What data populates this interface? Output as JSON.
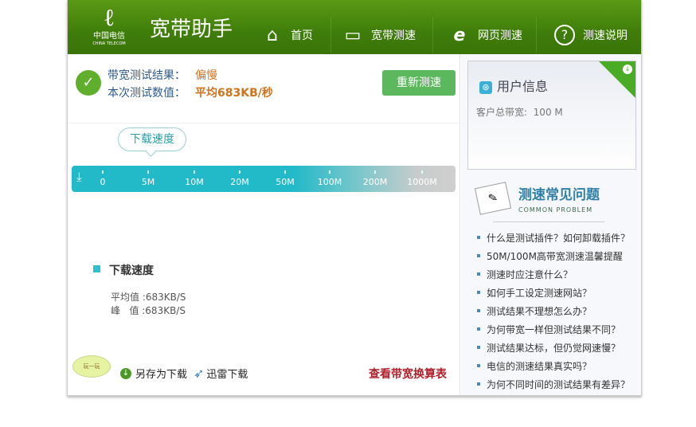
{
  "header": {
    "logo_cn": "中国电信",
    "logo_en": "CHINA TELECOM",
    "title": "宽带助手",
    "nav": [
      {
        "label": "首页",
        "icon": "home-icon"
      },
      {
        "label": "宽带测速",
        "icon": "monitor-icon"
      },
      {
        "label": "网页测速",
        "icon": "ie-icon"
      },
      {
        "label": "测速说明",
        "icon": "help-icon"
      }
    ]
  },
  "result": {
    "result_label": "带宽测试结果：",
    "result_value": "偏慢",
    "value_label": "本次测试数值：",
    "value": "平均683KB/秒",
    "retest": "重新测速"
  },
  "gauge": {
    "bubble": "下载速度",
    "ticks": [
      "0",
      "5M",
      "10M",
      "20M",
      "50M",
      "100M",
      "200M",
      "1000M"
    ]
  },
  "stats": {
    "legend": "下载速度",
    "avg": "平均值 :683KB/S",
    "peak": "峰   值 :683KB/S"
  },
  "footer": {
    "cloud": "玩一玩",
    "save": "另存为下载",
    "thunder": "迅雷下载",
    "conv": "查看带宽换算表"
  },
  "user": {
    "title": "用户信息",
    "bandwidth": "客户总带宽:  100 M"
  },
  "faq": {
    "title": "测速常见问题",
    "subtitle": "COMMON PROBLEM",
    "items": [
      "什么是测试插件？如何卸载插件？",
      "50M/100M高带宽测速温馨提醒",
      "测速时应注意什么？",
      "如何手工设定测速网站？",
      "测试结果不理想怎么办？",
      "为何带宽一样但测试结果不同？",
      "测试结果达标，但仍觉网速慢？",
      "电信的测速结果真实吗？",
      "为何不同时间的测试结果有差异？"
    ]
  }
}
